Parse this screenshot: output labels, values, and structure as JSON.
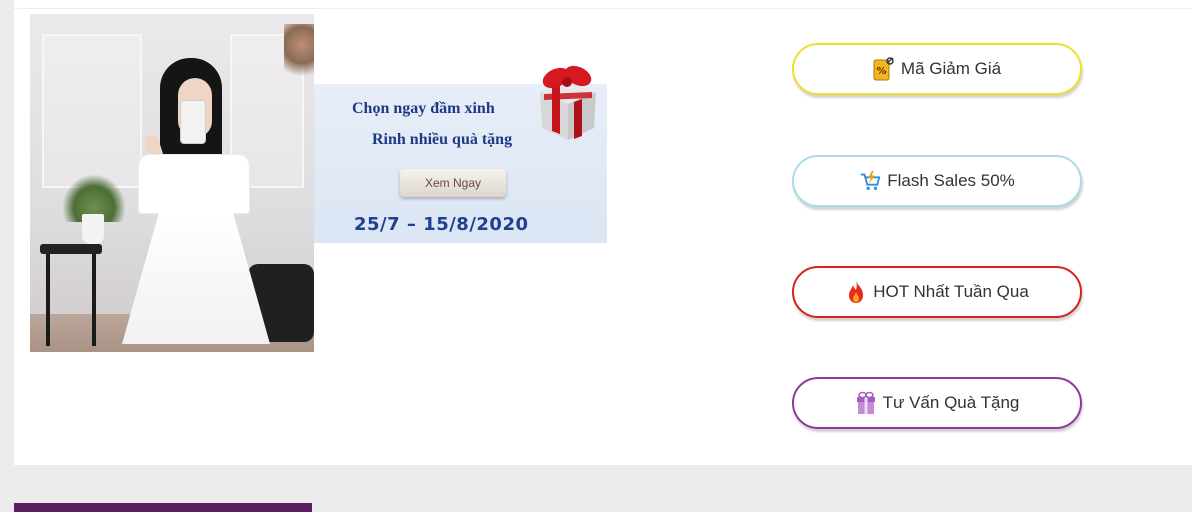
{
  "banner": {
    "line1": "Chọn ngay đầm xinh",
    "line2": "Rinh nhiều quà tặng",
    "button_label": "Xem Ngay",
    "dates": "25/7 – 15/8/2020"
  },
  "quick_links": [
    {
      "label": "Mã Giảm Giá",
      "icon": "coupon-icon",
      "border_color": "#f1df2a"
    },
    {
      "label": "Flash Sales 50%",
      "icon": "cart-flash-icon",
      "border_color": "#a9dde8"
    },
    {
      "label": "HOT Nhất Tuần Qua",
      "icon": "fire-icon",
      "border_color": "#d6231f"
    },
    {
      "label": "Tư Vấn Quà Tặng",
      "icon": "gift-icon",
      "border_color": "#8e3a98"
    }
  ],
  "colors": {
    "page_background": "#ececec",
    "banner_text": "#1d3a86",
    "footer_bar": "#5b1e61"
  }
}
